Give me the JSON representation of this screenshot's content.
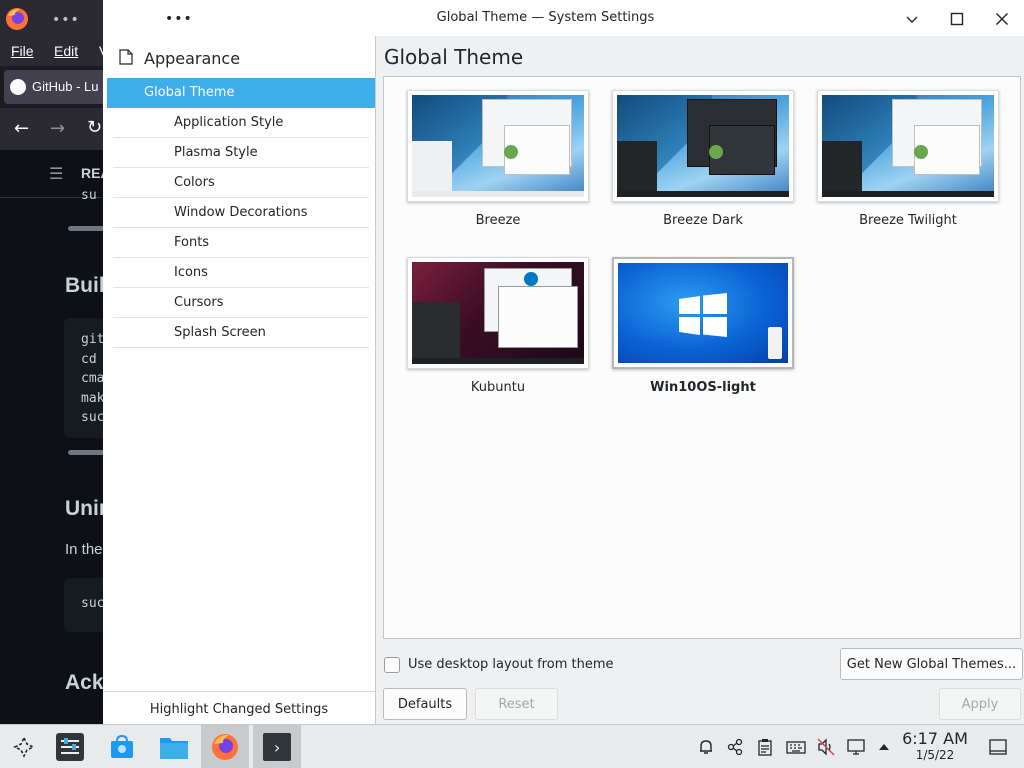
{
  "firefox": {
    "menu": [
      "File",
      "Edit",
      "V"
    ],
    "tab_title": "GitHub - Lu",
    "readme_label": "REA",
    "text_snippet": "su",
    "heading_build": "Buil",
    "code_block": [
      "git",
      "cd",
      "cma",
      "mak",
      "suc"
    ],
    "heading_uninstall": "Unin",
    "uninstall_text": "In the",
    "code_block2": "suc",
    "heading_ack": "Ack"
  },
  "window": {
    "title": "Global Theme — System Settings"
  },
  "sidebar": {
    "header": "Appearance",
    "selected": "Global Theme",
    "items": [
      "Application Style",
      "Plasma Style",
      "Colors",
      "Window Decorations",
      "Fonts",
      "Icons",
      "Cursors",
      "Splash Screen"
    ],
    "footer": "Highlight Changed Settings"
  },
  "main": {
    "title": "Global Theme",
    "themes": [
      {
        "name": "Breeze"
      },
      {
        "name": "Breeze Dark"
      },
      {
        "name": "Breeze Twilight"
      },
      {
        "name": "Kubuntu"
      },
      {
        "name": "Win10OS-light",
        "selected": true
      }
    ],
    "checkbox_label": "Use desktop layout from theme",
    "get_new_label": "Get New Global Themes...",
    "defaults_label": "Defaults",
    "reset_label": "Reset",
    "apply_label": "Apply"
  },
  "taskbar": {
    "time": "6:17 AM",
    "date": "1/5/22",
    "icons": [
      "app-launcher-icon",
      "system-settings-icon",
      "discover-store-icon",
      "file-manager-icon",
      "firefox-icon",
      "terminal-icon"
    ],
    "tray": [
      "notifications-icon",
      "network-share-icon",
      "clipboard-icon",
      "keyboard-icon",
      "volume-muted-icon",
      "display-icon",
      "expand-tray-icon",
      "show-desktop-icon"
    ]
  },
  "colors": {
    "accent": "#3daee9",
    "window_bg": "#eff0f1",
    "github_bg": "#0d1117"
  }
}
